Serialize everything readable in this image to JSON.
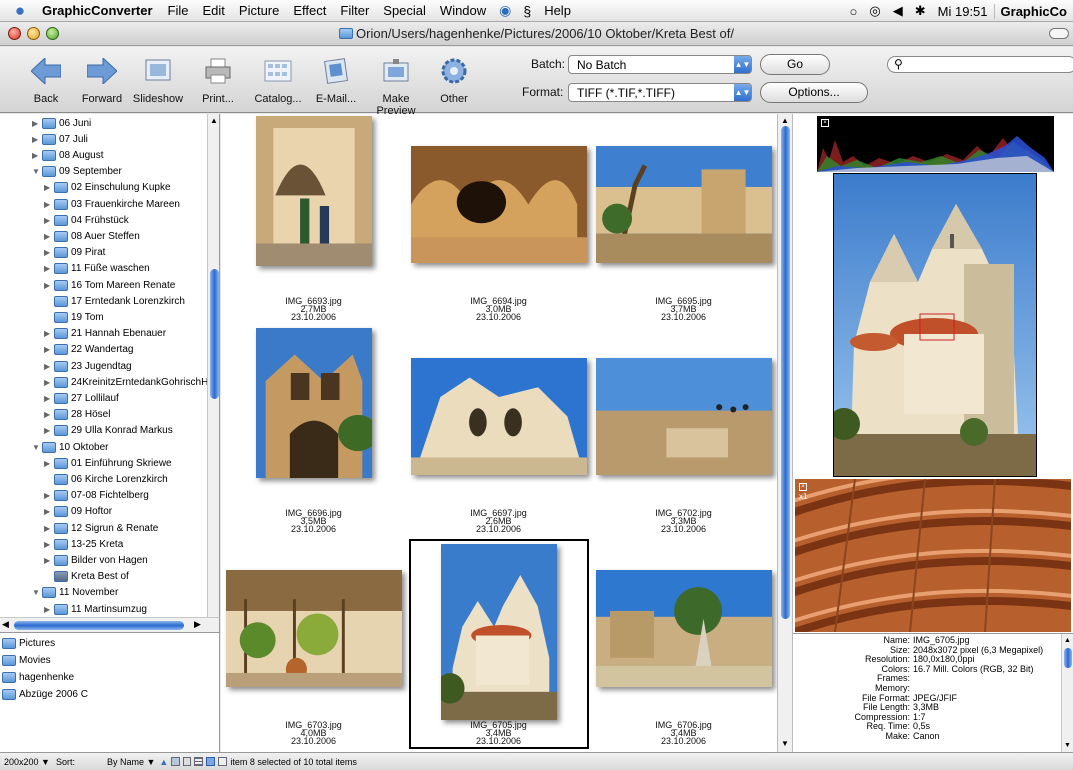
{
  "menubar": {
    "app_name": "GraphicConverter",
    "items": [
      "File",
      "Edit",
      "Picture",
      "Effect",
      "Filter",
      "Special",
      "Window",
      "Help"
    ],
    "clock": "Mi 19:51",
    "app_switcher": "GraphicCo"
  },
  "window": {
    "title": "Orion/Users/hagenhenke/Pictures/2006/10 Oktober/Kreta Best of/"
  },
  "toolbar": {
    "buttons": [
      {
        "label": "Back",
        "icon": "back-arrow-icon"
      },
      {
        "label": "Forward",
        "icon": "forward-arrow-icon"
      },
      {
        "label": "Slideshow",
        "icon": "slideshow-icon"
      },
      {
        "label": "Print...",
        "icon": "printer-icon"
      },
      {
        "label": "Catalog...",
        "icon": "catalog-icon"
      },
      {
        "label": "E-Mail...",
        "icon": "email-icon"
      },
      {
        "label": "Make Preview",
        "icon": "preview-icon"
      },
      {
        "label": "Other",
        "icon": "gear-icon"
      }
    ],
    "batch_label": "Batch:",
    "batch_value": "No Batch",
    "format_label": "Format:",
    "format_value": "TIFF (*.TIF,*.TIFF)",
    "go_label": "Go",
    "options_label": "Options..."
  },
  "sidebar": {
    "items": [
      {
        "label": "06 Juni",
        "level": 0,
        "expanded": false
      },
      {
        "label": "07 Juli",
        "level": 0,
        "expanded": false
      },
      {
        "label": "08 August",
        "level": 0,
        "expanded": false
      },
      {
        "label": "09 September",
        "level": 0,
        "expanded": true
      },
      {
        "label": "02 Einschulung Kupke",
        "level": 1,
        "expanded": false
      },
      {
        "label": "03 Frauenkirche Mareen",
        "level": 1,
        "expanded": false
      },
      {
        "label": "04 Frühstück",
        "level": 1,
        "expanded": false
      },
      {
        "label": "08 Auer Steffen",
        "level": 1,
        "expanded": false
      },
      {
        "label": "09 Pirat",
        "level": 1,
        "expanded": false
      },
      {
        "label": "11 Füße waschen",
        "level": 1,
        "expanded": false
      },
      {
        "label": "16 Tom Mareen Renate",
        "level": 1,
        "expanded": false
      },
      {
        "label": "17 Erntedank Lorenzkirch",
        "level": 1,
        "leaf": true
      },
      {
        "label": "19 Tom",
        "level": 1,
        "leaf": true
      },
      {
        "label": "21 Hannah Ebenauer",
        "level": 1,
        "expanded": false
      },
      {
        "label": "22 Wandertag",
        "level": 1,
        "expanded": false
      },
      {
        "label": "23 Jugendtag",
        "level": 1,
        "expanded": false
      },
      {
        "label": "24KreinitzErntedankGohrischHe...",
        "level": 1,
        "expanded": false
      },
      {
        "label": "27 Lollilauf",
        "level": 1,
        "expanded": false
      },
      {
        "label": "28 Hösel",
        "level": 1,
        "expanded": false
      },
      {
        "label": "29 Ulla Konrad Markus",
        "level": 1,
        "expanded": false
      },
      {
        "label": "10 Oktober",
        "level": 0,
        "expanded": true
      },
      {
        "label": "01 Einführung Skriewe",
        "level": 1,
        "expanded": false
      },
      {
        "label": "06 Kirche Lorenzkirch",
        "level": 1,
        "leaf": true
      },
      {
        "label": "07-08 Fichtelberg",
        "level": 1,
        "expanded": false
      },
      {
        "label": "09 Hoftor",
        "level": 1,
        "expanded": false
      },
      {
        "label": "12 Sigrun & Renate",
        "level": 1,
        "expanded": false
      },
      {
        "label": "13-25 Kreta",
        "level": 1,
        "expanded": false
      },
      {
        "label": "Bilder von Hagen",
        "level": 1,
        "expanded": false
      },
      {
        "label": "Kreta Best of",
        "level": 1,
        "leaf": true,
        "selected": true
      },
      {
        "label": "11 November",
        "level": 0,
        "expanded": true
      },
      {
        "label": "11 Martinsumzug",
        "level": 1,
        "expanded": false
      }
    ]
  },
  "places": {
    "items": [
      "Pictures",
      "Movies",
      "hagenhenke",
      "Abzüge 2006 C"
    ]
  },
  "thumbnails": [
    {
      "name": "IMG_6693.jpg",
      "size": "2,7MB",
      "date": "23.10.2006",
      "orient": "portrait"
    },
    {
      "name": "IMG_6694.jpg",
      "size": "3,0MB",
      "date": "23.10.2006",
      "orient": "landscape"
    },
    {
      "name": "IMG_6695.jpg",
      "size": "3,7MB",
      "date": "23.10.2006",
      "orient": "landscape"
    },
    {
      "name": "IMG_6696.jpg",
      "size": "3,5MB",
      "date": "23.10.2006",
      "orient": "portrait"
    },
    {
      "name": "IMG_6697.jpg",
      "size": "2,6MB",
      "date": "23.10.2006",
      "orient": "landscape"
    },
    {
      "name": "IMG_6702.jpg",
      "size": "3,3MB",
      "date": "23.10.2006",
      "orient": "landscape"
    },
    {
      "name": "IMG_6703.jpg",
      "size": "4,0MB",
      "date": "23.10.2006",
      "orient": "landscape"
    },
    {
      "name": "IMG_6705.jpg",
      "size": "3,4MB",
      "date": "23.10.2006",
      "orient": "portrait",
      "selected": true
    },
    {
      "name": "IMG_6706.jpg",
      "size": "3,4MB",
      "date": "23.10.2006",
      "orient": "landscape"
    }
  ],
  "info": {
    "rows": [
      {
        "key": "Name:",
        "value": "IMG_6705.jpg"
      },
      {
        "key": "Size:",
        "value": "2048x3072 pixel (6,3 Megapixel)"
      },
      {
        "key": "Resolution:",
        "value": "180,0x180,0ppi"
      },
      {
        "key": "Colors:",
        "value": "16.7 Mill. Colors (RGB, 32 Bit)"
      },
      {
        "key": "Frames:",
        "value": ""
      },
      {
        "key": "Memory:",
        "value": ""
      },
      {
        "key": "File Format:",
        "value": "JPEG/JFIF"
      },
      {
        "key": "File Length:",
        "value": "3,3MB"
      },
      {
        "key": "Compression:",
        "value": "1:7"
      },
      {
        "key": "Req. Time:",
        "value": "0,5s"
      },
      {
        "key": "Make:",
        "value": "Canon"
      }
    ]
  },
  "zoom_label": "x1",
  "status": {
    "size_option": "200x200",
    "sort_label": "Sort:",
    "sort_value": "By Name",
    "selection_text": "item 8 selected of 10 total items"
  }
}
